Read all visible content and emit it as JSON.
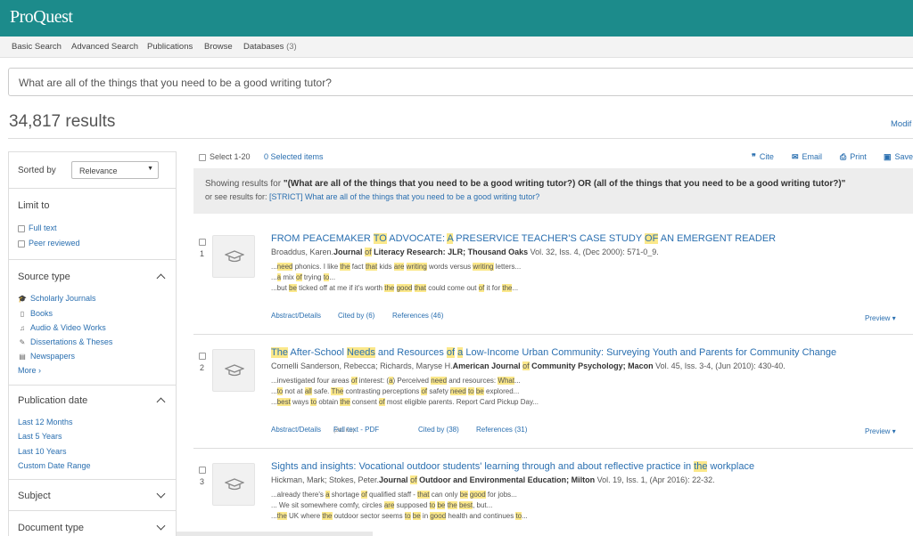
{
  "app": {
    "logo": "ProQuest"
  },
  "nav": {
    "items": [
      "Basic Search",
      "Advanced Search",
      "Publications",
      "Browse",
      "Databases"
    ],
    "databases_count": "(3)"
  },
  "search": {
    "query": "What are all of the things that you need to be a good writing tutor?"
  },
  "results": {
    "count": "34,817 results",
    "modify": "Modif"
  },
  "sidebar": {
    "sorted_by_label": "Sorted by",
    "sort_value": "Relevance",
    "limit_to": "Limit to",
    "limit_options": [
      "Full text",
      "Peer reviewed"
    ],
    "source_type": "Source type",
    "source_items": [
      {
        "label": "Scholarly Journals",
        "icon": "mortarboard-icon"
      },
      {
        "label": "Books",
        "icon": "book-icon"
      },
      {
        "label": "Audio & Video Works",
        "icon": "headphones-icon"
      },
      {
        "label": "Dissertations & Theses",
        "icon": "diploma-icon"
      },
      {
        "label": "Newspapers",
        "icon": "newspaper-icon"
      }
    ],
    "more": "More ›",
    "pub_date": "Publication date",
    "pub_items": [
      "Last 12 Months",
      "Last 5 Years",
      "Last 10 Years",
      "Custom Date Range"
    ],
    "subject": "Subject",
    "document_type": "Document type"
  },
  "toolbar": {
    "select": "Select 1-20",
    "selected": "0 Selected items",
    "cite": "Cite",
    "email": "Email",
    "print": "Print",
    "save": "Save"
  },
  "showing": {
    "prefix": "Showing results for ",
    "query": "\"(What are all of the things that you need to be a good writing tutor?) OR (all of the things that you need to be a good writing tutor?)\"",
    "or_see": "or see results for: ",
    "strict": "[STRICT] What are all of the things that you need to be a good writing tutor?"
  },
  "result_list": [
    {
      "num": "1",
      "title_parts": [
        [
          "FROM PEACEMAKER ",
          0
        ],
        [
          "TO",
          1
        ],
        [
          " ADVOCATE: ",
          0
        ],
        [
          "A",
          1
        ],
        [
          " PRESERVICE TEACHER'S CASE STUDY ",
          0
        ],
        [
          "OF",
          1
        ],
        [
          " AN EMERGENT READER",
          0
        ]
      ],
      "meta_parts": [
        [
          "Broaddus, Karen.",
          0
        ],
        [
          "Journal ",
          2
        ],
        [
          "of",
          1
        ],
        [
          " Literacy Research: JLR; Thousand Oaks",
          2
        ],
        [
          " Vol. 32, Iss. 4,  (Dec 2000): 571-0_9.",
          0
        ]
      ],
      "snippets": [
        [
          [
            "...",
            0
          ],
          [
            "need",
            1
          ],
          [
            " phonics. I like ",
            0
          ],
          [
            "the",
            1
          ],
          [
            " fact ",
            0
          ],
          [
            "that",
            1
          ],
          [
            " kids ",
            0
          ],
          [
            "are",
            1
          ],
          [
            " ",
            0
          ],
          [
            "writing",
            1
          ],
          [
            " words versus ",
            0
          ],
          [
            "writing",
            1
          ],
          [
            " letters...",
            0
          ]
        ],
        [
          [
            "...",
            0
          ],
          [
            "a",
            1
          ],
          [
            " mix ",
            0
          ],
          [
            "of",
            1
          ],
          [
            " trying ",
            0
          ],
          [
            "to",
            1
          ],
          [
            "...",
            0
          ]
        ],
        [
          [
            "...but ",
            0
          ],
          [
            "be",
            1
          ],
          [
            " ticked off at me if it's worth ",
            0
          ],
          [
            "the",
            1
          ],
          [
            " ",
            0
          ],
          [
            "good",
            1
          ],
          [
            " ",
            0
          ],
          [
            "that",
            1
          ],
          [
            " could come out ",
            0
          ],
          [
            "of",
            1
          ],
          [
            " it for ",
            0
          ],
          [
            "the",
            1
          ],
          [
            "...",
            0
          ]
        ]
      ],
      "links": [
        "Abstract/Details",
        "Cited by (6)",
        "References (46)"
      ],
      "preview": "Preview ▾"
    },
    {
      "num": "2",
      "title_parts": [
        [
          "The",
          1
        ],
        [
          " After-School ",
          0
        ],
        [
          "Needs",
          1
        ],
        [
          " and Resources ",
          0
        ],
        [
          "of",
          1
        ],
        [
          " ",
          0
        ],
        [
          "a",
          1
        ],
        [
          " Low-Income Urban Community: Surveying Youth and Parents for Community Change",
          0
        ]
      ],
      "meta_parts": [
        [
          "Cornelli Sanderson, Rebecca; Richards, Maryse H.",
          0
        ],
        [
          "American Journal ",
          2
        ],
        [
          "of",
          1
        ],
        [
          " Community Psychology; Macon",
          2
        ],
        [
          " Vol. 45, Iss. 3-4,  (Jun 2010): 430-40.",
          0
        ]
      ],
      "snippets": [
        [
          [
            "...investigated four areas ",
            0
          ],
          [
            "of",
            1
          ],
          [
            " interest: (",
            0
          ],
          [
            "a",
            1
          ],
          [
            ") Perceived ",
            0
          ],
          [
            "need",
            1
          ],
          [
            " and resources: ",
            0
          ],
          [
            "What",
            1
          ],
          [
            "...",
            0
          ]
        ],
        [
          [
            "...",
            0
          ],
          [
            "to",
            1
          ],
          [
            " not at ",
            0
          ],
          [
            "all",
            1
          ],
          [
            " safe. ",
            0
          ],
          [
            "The",
            1
          ],
          [
            " contrasting perceptions ",
            0
          ],
          [
            "of",
            1
          ],
          [
            " safety ",
            0
          ],
          [
            "need",
            1
          ],
          [
            " ",
            0
          ],
          [
            "to",
            1
          ],
          [
            " ",
            0
          ],
          [
            "be",
            1
          ],
          [
            " explored...",
            0
          ]
        ],
        [
          [
            "...",
            0
          ],
          [
            "best",
            1
          ],
          [
            " ways ",
            0
          ],
          [
            "to",
            1
          ],
          [
            " obtain ",
            0
          ],
          [
            "the",
            1
          ],
          [
            " consent ",
            0
          ],
          [
            "of",
            1
          ],
          [
            " most eligible parents. Report Card Pickup Day...",
            0
          ]
        ]
      ],
      "links": [
        "Abstract/Details",
        "Full text - PDF",
        "Cited by (38)",
        "References (31)"
      ],
      "pdf_size": "(241 KB)",
      "preview": "Preview ▾"
    },
    {
      "num": "3",
      "title_parts": [
        [
          "Sights and insights: Vocational outdoor students' learning through and about reflective practice in ",
          0
        ],
        [
          "the",
          1
        ],
        [
          " workplace",
          0
        ]
      ],
      "meta_parts": [
        [
          "Hickman, Mark; Stokes, Peter.",
          0
        ],
        [
          "Journal ",
          2
        ],
        [
          "of",
          1
        ],
        [
          " Outdoor and Environmental Education; Milton",
          2
        ],
        [
          " Vol. 19, Iss. 1,  (Apr 2016): 22-32.",
          0
        ]
      ],
      "snippets": [
        [
          [
            "...already there's ",
            0
          ],
          [
            "a",
            1
          ],
          [
            " shortage ",
            0
          ],
          [
            "of",
            1
          ],
          [
            " qualified staff - ",
            0
          ],
          [
            "that",
            1
          ],
          [
            " can only ",
            0
          ],
          [
            "be",
            1
          ],
          [
            " ",
            0
          ],
          [
            "good",
            1
          ],
          [
            " for jobs...",
            0
          ]
        ],
        [
          [
            "... We sit somewhere comfy, circles ",
            0
          ],
          [
            "are",
            1
          ],
          [
            " supposed ",
            0
          ],
          [
            "to",
            1
          ],
          [
            " ",
            0
          ],
          [
            "be",
            1
          ],
          [
            " ",
            0
          ],
          [
            "the",
            1
          ],
          [
            " ",
            0
          ],
          [
            "best",
            1
          ],
          [
            ", but...",
            0
          ]
        ],
        [
          [
            "...",
            0
          ],
          [
            "the",
            1
          ],
          [
            " UK where ",
            0
          ],
          [
            "the",
            1
          ],
          [
            " outdoor sector seems ",
            0
          ],
          [
            "to",
            1
          ],
          [
            " ",
            0
          ],
          [
            "be",
            1
          ],
          [
            " in ",
            0
          ],
          [
            "good",
            1
          ],
          [
            " health and continues ",
            0
          ],
          [
            "to",
            1
          ],
          [
            "...",
            0
          ]
        ]
      ]
    }
  ]
}
